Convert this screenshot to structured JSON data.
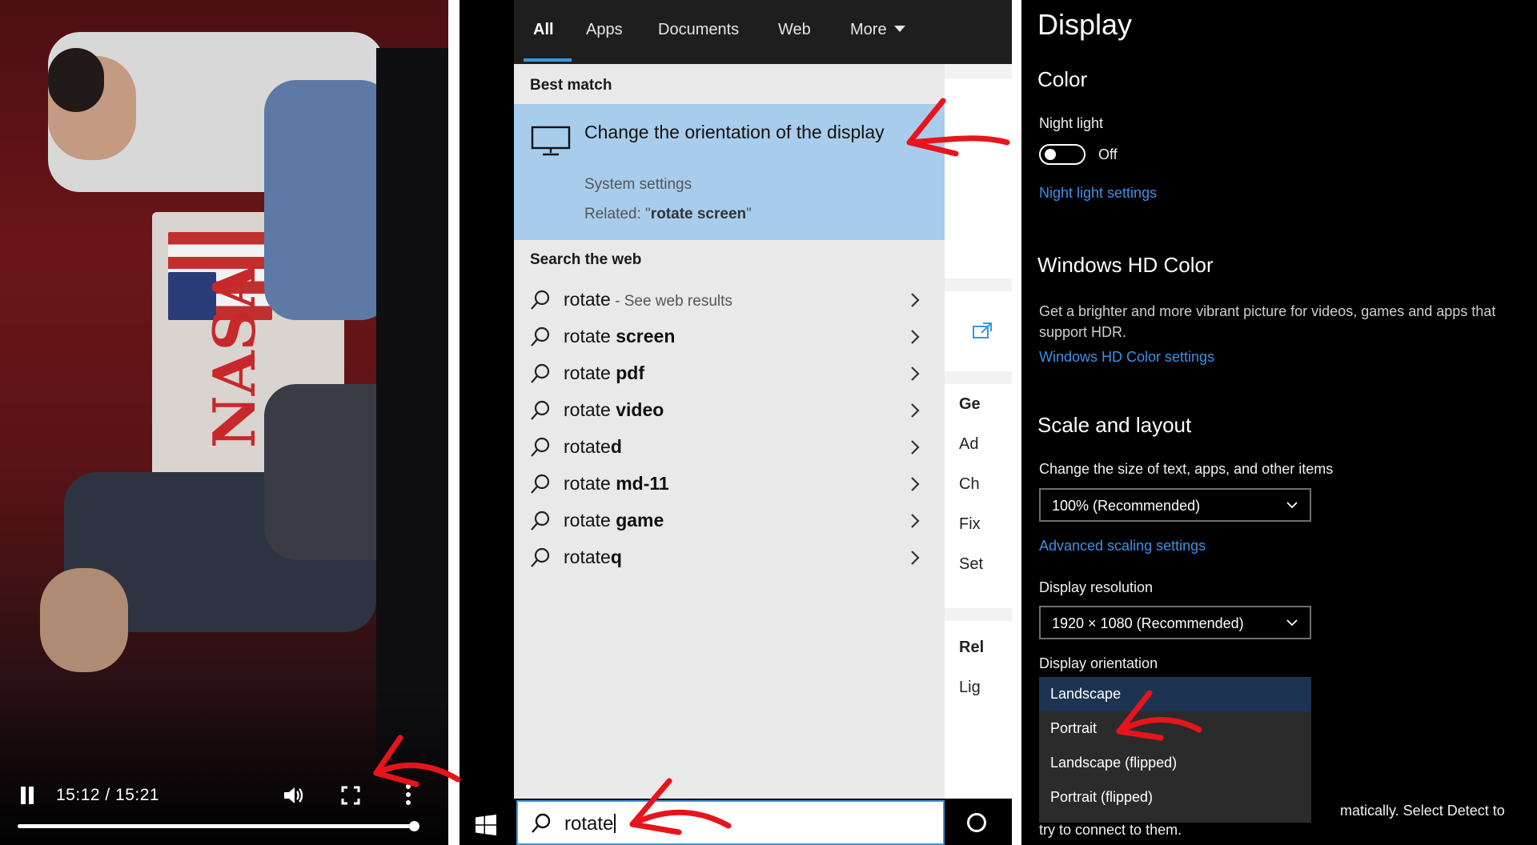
{
  "video": {
    "time": "15:12 / 15:21",
    "progress": 0.99,
    "backdrop_text": "NASA",
    "controls": [
      "pause",
      "volume",
      "fullscreen",
      "more"
    ]
  },
  "search": {
    "tabs": [
      "All",
      "Apps",
      "Documents",
      "Web",
      "More"
    ],
    "active_tab": "All",
    "best_match": {
      "header": "Best match",
      "title": "Change the orientation of the display",
      "subtitle": "System settings",
      "related_prefix": "Related: \"",
      "related_term": "rotate screen",
      "related_suffix": "\"",
      "icon": "monitor-icon"
    },
    "web": {
      "header": "Search the web",
      "items": [
        {
          "prefix": "rotate",
          "bold": "",
          "hint": " - See web results"
        },
        {
          "prefix": "rotate ",
          "bold": "screen",
          "hint": ""
        },
        {
          "prefix": "rotate ",
          "bold": "pdf",
          "hint": ""
        },
        {
          "prefix": "rotate ",
          "bold": "video",
          "hint": ""
        },
        {
          "prefix": "rotate",
          "bold": "d",
          "hint": ""
        },
        {
          "prefix": "rotate ",
          "bold": "md-11",
          "hint": ""
        },
        {
          "prefix": "rotate ",
          "bold": "game",
          "hint": ""
        },
        {
          "prefix": "rotate",
          "bold": "q",
          "hint": ""
        }
      ]
    },
    "preview": {
      "items": [
        "Ge",
        "Ad",
        "Ch",
        "Fix",
        "Set"
      ],
      "related_header": "Rel",
      "related_items": [
        "Lig"
      ]
    },
    "input_value": "rotate"
  },
  "display": {
    "title": "Display",
    "color": {
      "header": "Color",
      "night_light_label": "Night light",
      "night_light_state": "Off",
      "night_light_link": "Night light settings"
    },
    "hd": {
      "header": "Windows HD Color",
      "description": "Get a brighter and more vibrant picture for videos, games and apps that support HDR.",
      "link": "Windows HD Color settings"
    },
    "scale": {
      "header": "Scale and layout",
      "size_label": "Change the size of text, apps, and other items",
      "size_value": "100% (Recommended)",
      "advanced_link": "Advanced scaling settings",
      "resolution_label": "Display resolution",
      "resolution_value": "1920 × 1080 (Recommended)",
      "orientation_label": "Display orientation",
      "orientation_options": [
        "Landscape",
        "Portrait",
        "Landscape (flipped)",
        "Portrait (flipped)"
      ],
      "orientation_selected": "Landscape"
    },
    "footer_text_1": "matically. Select Detect to",
    "footer_text_2": "try to connect to them."
  },
  "colors": {
    "accent": "#3a96dd",
    "link": "#3e8fe6",
    "best_match_bg": "#a8cdec",
    "annotation_arrow": "#e8141b"
  }
}
